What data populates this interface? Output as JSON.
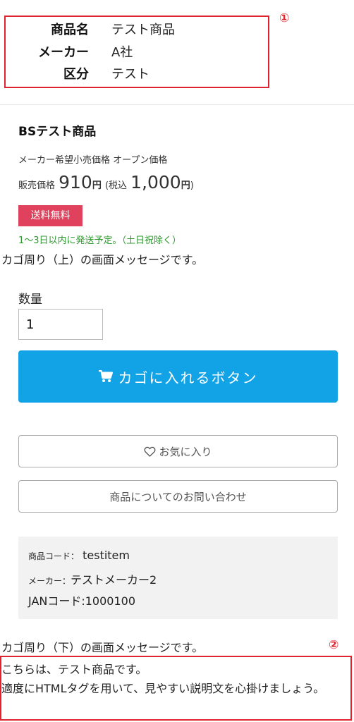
{
  "spec": {
    "rows": [
      {
        "label": "商品名",
        "value": "テスト商品"
      },
      {
        "label": "メーカー",
        "value": "A社"
      },
      {
        "label": "区分",
        "value": "テスト"
      }
    ],
    "marker": "①"
  },
  "product": {
    "title": "BSテスト商品",
    "msrp": "メーカー希望小売価格 オープン価格",
    "price_label": "販売価格",
    "price": "910",
    "yen": "円",
    "tax_label": "(税込",
    "price_tax": "1,000",
    "yen_tax": "円",
    "close_paren": ")",
    "badge": "送料無料",
    "shipping_note": "1〜3日以内に発送予定。（土日祝除く）"
  },
  "cart": {
    "message_top": "カゴ周り（上）の画面メッセージです。",
    "qty_label": "数量",
    "qty_value": "1",
    "add_button": "カゴに入れるボタン",
    "favorite_button": "お気に入り",
    "inquiry_button": "商品についてのお問い合わせ",
    "message_bottom": "カゴ周り（下）の画面メッセージです。"
  },
  "info": {
    "code_label": "商品コード：",
    "code_value": "testitem",
    "maker_label": "メーカー：",
    "maker_value": "テストメーカー2",
    "jan": "JANコード:1000100"
  },
  "description": {
    "marker": "②",
    "text": "こちらは、テスト商品です。\n適度にHTMLタグを用いて、見やすい説明文を心掛けましょう。"
  },
  "colors": {
    "accent": "#12a2e6",
    "highlight_border": "#e0242f",
    "badge": "#e0415c",
    "ship_note": "#2e9a2e"
  }
}
